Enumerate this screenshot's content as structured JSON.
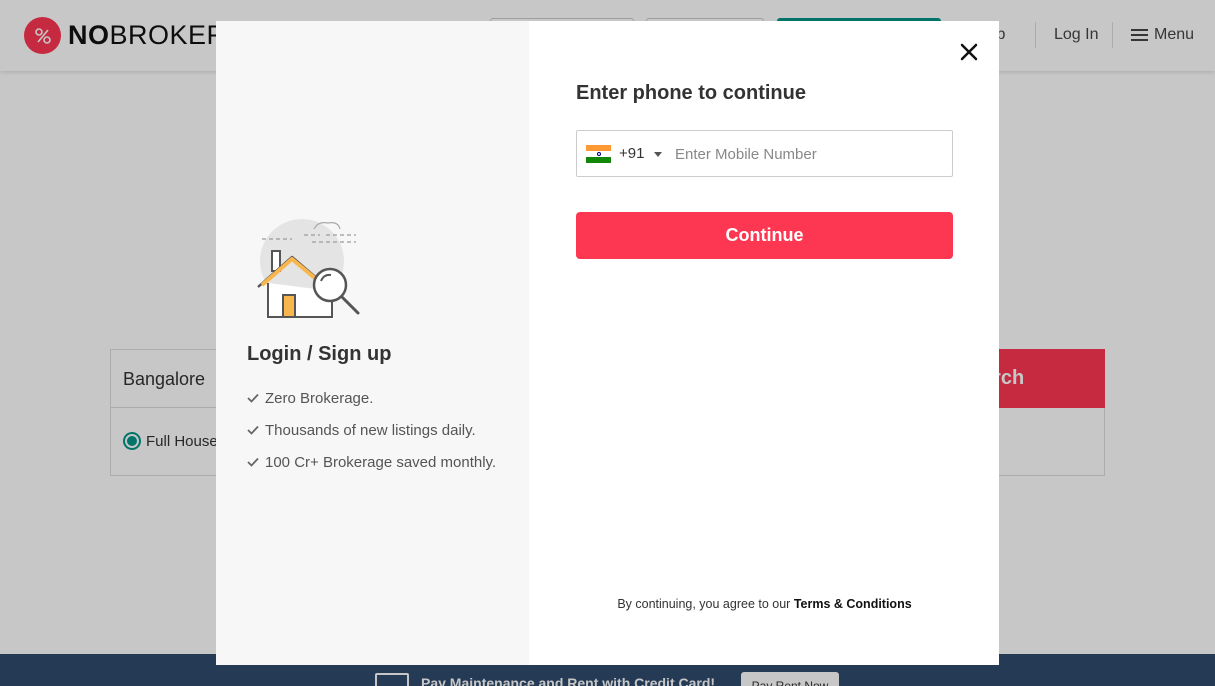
{
  "header": {
    "logo_text_bold": "NO",
    "logo_text_rest": "BROKER",
    "signup_label": "Up",
    "login_label": "Log In",
    "menu_label": "Menu"
  },
  "search": {
    "city": "Bangalore",
    "button_label": "earch",
    "property_type": "Full House"
  },
  "footer": {
    "banner_text": "Pay Maintenance and Rent with Credit Card!",
    "button_label": "Pay Rent Now"
  },
  "modal": {
    "left": {
      "title": "Login / Sign up",
      "benefits": [
        "Zero Brokerage.",
        "Thousands of new listings daily.",
        "100 Cr+ Brokerage saved monthly."
      ]
    },
    "right": {
      "title": "Enter phone to continue",
      "country_code": "+91",
      "phone_placeholder": "Enter Mobile Number",
      "phone_value": "",
      "continue_label": "Continue",
      "terms_prefix": "By continuing, you agree to our ",
      "terms_link": "Terms & Conditions"
    }
  },
  "colors": {
    "brand_red": "#fd3752",
    "brand_teal": "#009587",
    "footer_navy": "#2f4b6e"
  },
  "icons": {
    "close": "close-icon",
    "country_flag": "india-flag-icon",
    "check": "check-icon",
    "illustration": "house-search-icon",
    "menu": "hamburger-icon"
  }
}
